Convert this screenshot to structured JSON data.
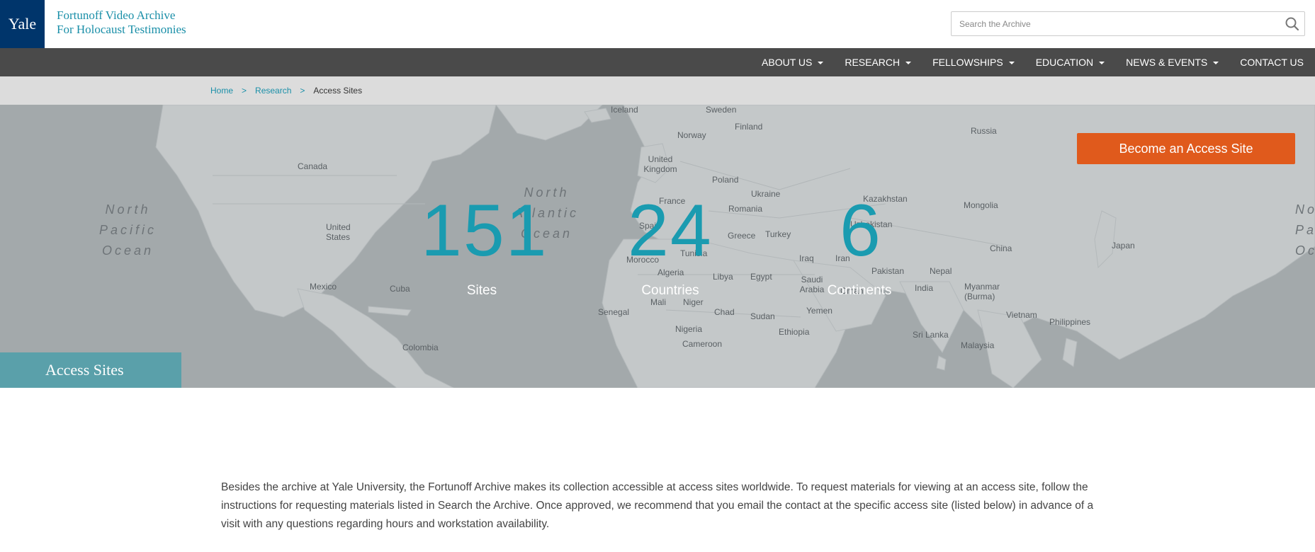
{
  "header": {
    "logo": "Yale",
    "archive_name_line1": "Fortunoff Video Archive",
    "archive_name_line2": "For Holocaust Testimonies",
    "search_placeholder": "Search the Archive",
    "search_icon": "search-icon"
  },
  "nav": {
    "items": [
      {
        "label": "ABOUT US",
        "dropdown": true
      },
      {
        "label": "RESEARCH",
        "dropdown": true
      },
      {
        "label": "FELLOWSHIPS",
        "dropdown": true
      },
      {
        "label": "EDUCATION",
        "dropdown": true
      },
      {
        "label": "NEWS & EVENTS",
        "dropdown": true
      },
      {
        "label": "CONTACT US",
        "dropdown": false
      }
    ]
  },
  "breadcrumb": {
    "home": "Home",
    "research": "Research",
    "current": "Access Sites",
    "separator": ">"
  },
  "hero": {
    "button_label": "Become an Access Site",
    "stats": [
      {
        "value": "151",
        "label": "Sites"
      },
      {
        "value": "24",
        "label": "Countries"
      },
      {
        "value": "6",
        "label": "Continents"
      }
    ],
    "page_title": "Access Sites",
    "map_labels": [
      "Iceland",
      "Sweden",
      "Finland",
      "Norway",
      "Russia",
      "Canada",
      "United Kingdom",
      "Poland",
      "Ukraine",
      "Kazakhstan",
      "France",
      "Romania",
      "Mongolia",
      "United States",
      "Spain",
      "Greece",
      "Turkey",
      "Uzbekistan",
      "China",
      "Japan",
      "Tunisia",
      "Iraq",
      "Iran",
      "Morocco",
      "Algeria",
      "Libya",
      "Egypt",
      "Saudi Arabia",
      "Pakistan",
      "Nepal",
      "Mexico",
      "Cuba",
      "Oman",
      "India",
      "Myanmar (Burma)",
      "Mali",
      "Niger",
      "Yemen",
      "Senegal",
      "Chad",
      "Sudan",
      "Vietnam",
      "Philippines",
      "Nigeria",
      "Ethiopia",
      "Sri Lanka",
      "Cameroon",
      "Colombia",
      "Malaysia"
    ],
    "oceans": {
      "north_pacific": [
        "North",
        "Pacific",
        "Ocean"
      ],
      "north_atlantic": [
        "North",
        "Atlantic",
        "Ocean"
      ],
      "north_pacific_right": [
        "No",
        "Pac",
        "Oc"
      ]
    }
  },
  "intro_text": "Besides the archive at Yale University, the Fortunoff Archive makes its collection accessible at access sites worldwide. To request materials for viewing at an access site, follow the instructions for requesting materials listed in Search the Archive. Once approved, we recommend that you email the contact at the specific access site (listed below) in advance of a visit with any questions regarding hours and workstation availability.",
  "colors": {
    "yale_blue": "#00356b",
    "teal": "#1a9bb0",
    "orange": "#e05a1c",
    "nav_bg": "#4a4a4a",
    "breadcrumb_bg": "#dcdcdc",
    "tab_bg": "#5aa0aa"
  }
}
